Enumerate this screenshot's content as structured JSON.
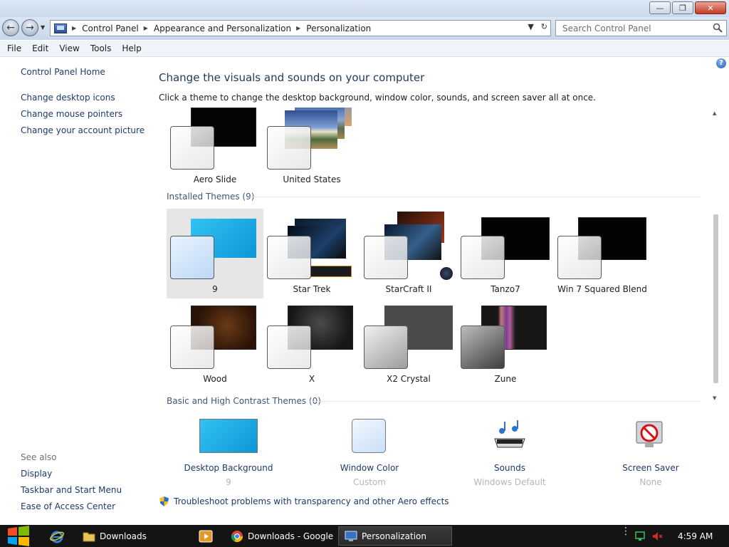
{
  "window": {
    "buttons": {
      "minimize": "—",
      "restore": "❐",
      "close": "✕"
    }
  },
  "address": {
    "crumbs": [
      "Control Panel",
      "Appearance and Personalization",
      "Personalization"
    ],
    "search_placeholder": "Search Control Panel"
  },
  "menu": [
    "File",
    "Edit",
    "View",
    "Tools",
    "Help"
  ],
  "sidebar": {
    "home": "Control Panel Home",
    "links": [
      "Change desktop icons",
      "Change mouse pointers",
      "Change your account picture"
    ],
    "see_also_label": "See also",
    "see_also": [
      "Display",
      "Taskbar and Start Menu",
      "Ease of Access Center"
    ]
  },
  "main": {
    "title": "Change the visuals and sounds on your computer",
    "subtitle": "Click a theme to change the desktop background, window color, sounds, and screen saver all at once.",
    "my_themes": [
      "Aero Slide",
      "United States"
    ],
    "installed_label": "Installed Themes (9)",
    "installed": [
      "9",
      "Star Trek",
      "StarCraft II",
      "Tanzo7",
      "Win 7 Squared Blend",
      "Wood",
      "X",
      "X2 Crystal",
      "Zune"
    ],
    "basic_label": "Basic and High Contrast Themes (0)"
  },
  "settings": [
    {
      "label": "Desktop Background",
      "value": "9"
    },
    {
      "label": "Window Color",
      "value": "Custom"
    },
    {
      "label": "Sounds",
      "value": "Windows Default"
    },
    {
      "label": "Screen Saver",
      "value": "None"
    }
  ],
  "troubleshoot": "Troubleshoot problems with transparency and other Aero effects",
  "taskbar": {
    "items": [
      "Downloads",
      "Downloads - Google ...",
      "Personalization"
    ],
    "clock": "4:59 AM"
  },
  "colors": {
    "link": "#1e3a6a",
    "title": "#1e395b",
    "selected_theme_bg": "#e6e6e6",
    "theme9_accent": "#1fb1e8"
  }
}
